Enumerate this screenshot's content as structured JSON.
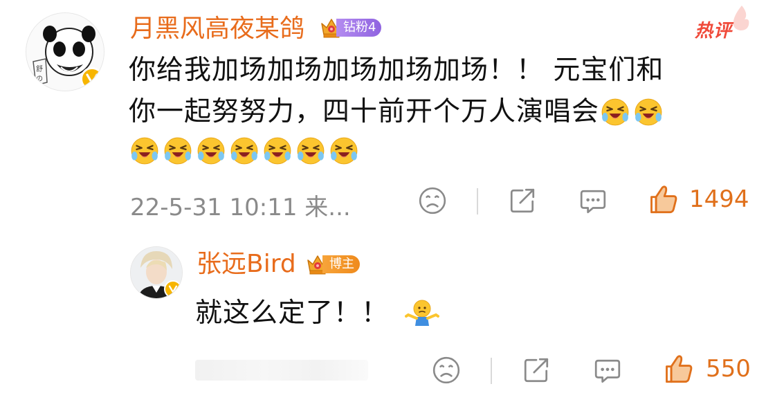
{
  "comment": {
    "username": "月黑风高夜某鸽",
    "rank_badge": "钻粉4",
    "hot_tag": "热评",
    "text_line1": "你给我加场加场加场加场加场！！ 元宝们和",
    "text_line2": "你一起努努力，四十前开个万人演唱会",
    "emoji_name": "laugh-cry-emoji",
    "emoji_count_line2": 2,
    "emoji_count_line3": 7,
    "meta": "22-5-31 10:11 来...",
    "likes": "1494"
  },
  "reply": {
    "username": "张远Bird",
    "role_badge": "博主",
    "text": "就这么定了！！",
    "emoji_name": "shrug-emoji",
    "likes": "550"
  },
  "colors": {
    "accent_orange": "#e86c1c",
    "hot_red": "#f04a3a",
    "verified_gold": "#f7b500",
    "meta_gray": "#8a8a8a"
  }
}
